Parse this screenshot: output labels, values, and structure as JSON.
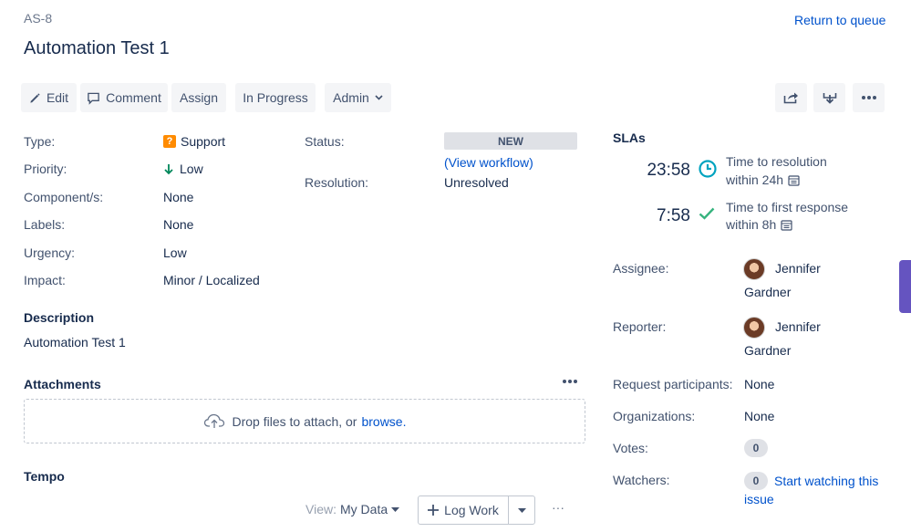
{
  "issue": {
    "key": "AS-8",
    "summary": "Automation Test 1",
    "return_link": "Return to queue"
  },
  "toolbar": {
    "edit": "Edit",
    "comment": "Comment",
    "assign": "Assign",
    "in_progress": "In Progress",
    "admin": "Admin"
  },
  "details": {
    "type_label": "Type:",
    "type_value": "Support",
    "priority_label": "Priority:",
    "priority_value": "Low",
    "components_label": "Component/s:",
    "components_value": "None",
    "labels_label": "Labels:",
    "labels_value": "None",
    "urgency_label": "Urgency:",
    "urgency_value": "Low",
    "impact_label": "Impact:",
    "impact_value": "Minor / Localized",
    "status_label": "Status:",
    "status_value": "NEW",
    "view_workflow_open": "(",
    "view_workflow": "View workflow",
    "view_workflow_close": ")",
    "resolution_label": "Resolution:",
    "resolution_value": "Unresolved"
  },
  "description": {
    "title": "Description",
    "text": "Automation Test 1"
  },
  "attachments": {
    "title": "Attachments",
    "drop_text": "Drop files to attach, or",
    "browse": "browse."
  },
  "tempo": {
    "title": "Tempo",
    "view_label": "View:",
    "view_value": "My Data",
    "log_work": "Log Work",
    "more": "···"
  },
  "slas": {
    "title": "SLAs",
    "items": [
      {
        "time": "23:58",
        "name": "Time to resolution",
        "goal": "within 24h",
        "icon": "clock-icon"
      },
      {
        "time": "7:58",
        "name": "Time to first response",
        "goal": "within 8h",
        "icon": "check-icon"
      }
    ]
  },
  "people": {
    "assignee_label": "Assignee:",
    "assignee_first": "Jennifer",
    "assignee_last": "Gardner",
    "reporter_label": "Reporter:",
    "reporter_first": "Jennifer",
    "reporter_last": "Gardner",
    "participants_label": "Request participants:",
    "participants_value": "None",
    "organizations_label": "Organizations:",
    "organizations_value": "None",
    "votes_label": "Votes:",
    "votes_count": "0",
    "watchers_label": "Watchers:",
    "watchers_count": "0",
    "watch_link_1": "Start watching this",
    "watch_link_2": "issue"
  },
  "colors": {
    "link": "#0052cc",
    "support_icon": "#ff8b00",
    "priority_low": "#00875a",
    "sla_clock": "#00a3bf",
    "sla_check": "#36b37e",
    "side_tab": "#6554c0"
  }
}
